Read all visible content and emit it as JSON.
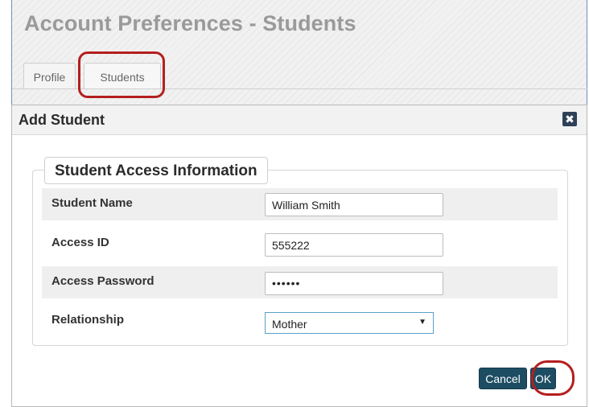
{
  "page": {
    "title": "Account Preferences - Students"
  },
  "tabs": [
    {
      "label": "Profile"
    },
    {
      "label": "Students"
    }
  ],
  "dialog": {
    "title": "Add Student",
    "close_glyph": "✖",
    "section_title": "Student Access Information",
    "fields": {
      "student_name": {
        "label": "Student Name",
        "value": "William Smith"
      },
      "access_id": {
        "label": "Access ID",
        "value": "555222"
      },
      "access_password": {
        "label": "Access Password",
        "value": "••••••"
      },
      "relationship": {
        "label": "Relationship",
        "value": "Mother"
      }
    },
    "buttons": {
      "cancel": "Cancel",
      "ok": "OK"
    }
  },
  "colors": {
    "primary_button": "#1d4d63",
    "highlight": "#b41e1e",
    "close_button": "#2f4158"
  }
}
